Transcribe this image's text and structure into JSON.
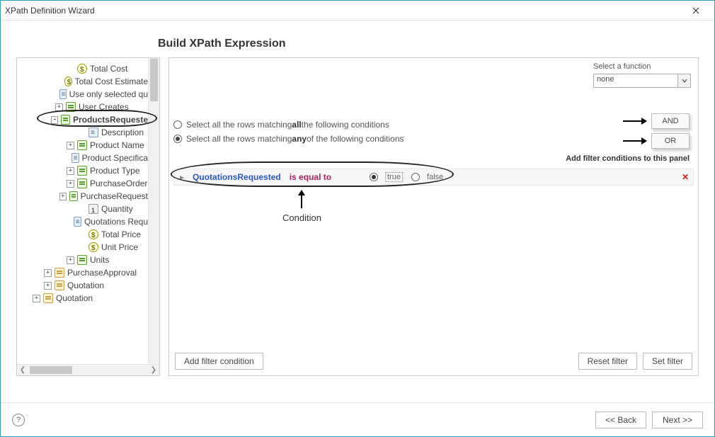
{
  "window": {
    "title": "XPath Definition Wizard"
  },
  "heading": "Build XPath Expression",
  "tree": {
    "items": [
      {
        "indent": 64,
        "icon": "dollar",
        "exp": "",
        "label": "Total Cost"
      },
      {
        "indent": 64,
        "icon": "dollar",
        "exp": "",
        "label": "Total Cost Estimate"
      },
      {
        "indent": 64,
        "icon": "text",
        "exp": "",
        "label": "Use only selected qu"
      },
      {
        "indent": 48,
        "icon": "field",
        "exp": "+",
        "label": "User Creates"
      },
      {
        "indent": 48,
        "icon": "field",
        "exp": "-",
        "label": "ProductsRequeste",
        "highlight": true
      },
      {
        "indent": 80,
        "icon": "text",
        "exp": "",
        "label": "Description"
      },
      {
        "indent": 64,
        "icon": "field",
        "exp": "+",
        "label": "Product Name"
      },
      {
        "indent": 80,
        "icon": "text",
        "exp": "",
        "label": "Product Specifica"
      },
      {
        "indent": 64,
        "icon": "field",
        "exp": "+",
        "label": "Product Type"
      },
      {
        "indent": 64,
        "icon": "field",
        "exp": "+",
        "label": "PurchaseOrder"
      },
      {
        "indent": 64,
        "icon": "field",
        "exp": "+",
        "label": "PurchaseRequest"
      },
      {
        "indent": 80,
        "icon": "one",
        "exp": "",
        "label": "Quantity"
      },
      {
        "indent": 80,
        "icon": "text",
        "exp": "",
        "label": "Quotations Requ"
      },
      {
        "indent": 80,
        "icon": "dollar",
        "exp": "",
        "label": "Total Price"
      },
      {
        "indent": 80,
        "icon": "dollar",
        "exp": "",
        "label": "Unit Price"
      },
      {
        "indent": 64,
        "icon": "field",
        "exp": "+",
        "label": "Units"
      },
      {
        "indent": 32,
        "icon": "entity",
        "exp": "+",
        "label": "PurchaseApproval"
      },
      {
        "indent": 32,
        "icon": "entity",
        "exp": "+",
        "label": "Quotation"
      },
      {
        "indent": 16,
        "icon": "entity",
        "exp": "+",
        "label": "Quotation"
      }
    ]
  },
  "func": {
    "label": "Select a function",
    "value": "none"
  },
  "match": {
    "all": {
      "pre": "Select all the rows matching ",
      "bold": "all",
      "post": " the following conditions"
    },
    "any": {
      "pre": "Select all the rows matching ",
      "bold": "any",
      "post": " of the following conditions"
    },
    "selected": "any",
    "and": "AND",
    "or": "OR"
  },
  "hint": "Add filter conditions to this panel",
  "condition": {
    "field": "QuotationsRequested",
    "op": "is equal to",
    "true": "true",
    "false": "false",
    "caption": "Condition"
  },
  "buttons": {
    "add": "Add filter condition",
    "reset": "Reset  filter",
    "set": "Set  filter"
  },
  "footer": {
    "back": "<< Back",
    "next": "Next >>"
  }
}
